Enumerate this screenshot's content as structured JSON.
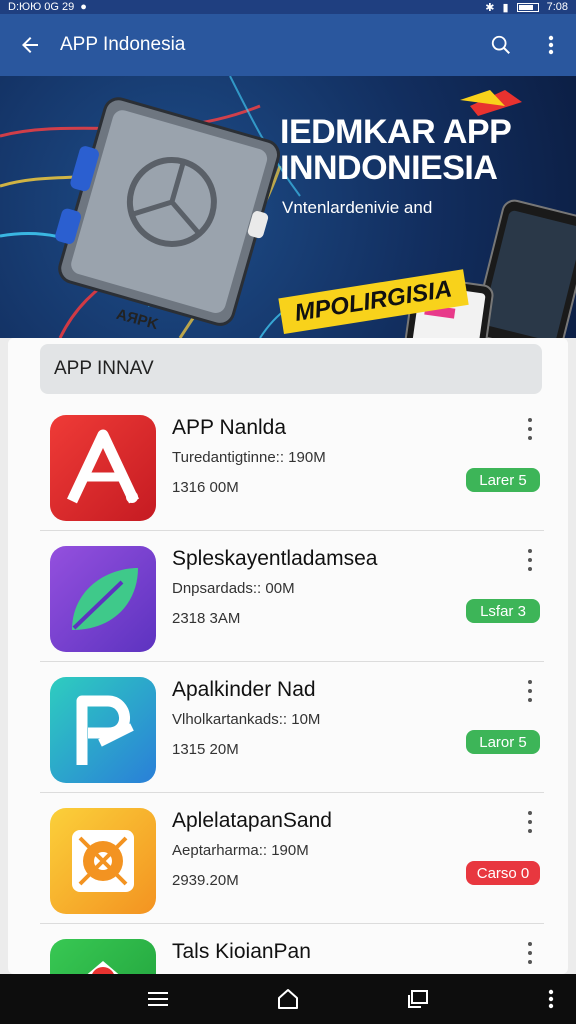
{
  "status_bar": {
    "time_left": "D:ЮЮ 0G 29",
    "time_right": "7:08"
  },
  "app_bar": {
    "title": "APP Indonesia",
    "icons": [
      "back-arrow-icon",
      "search-icon",
      "more-vert-icon"
    ]
  },
  "banner": {
    "title": "IEDMKAR APP INNDONIESIA",
    "subtitle": "Vntenlardenivie and",
    "tag": "MPOLIRGISIA",
    "card_label": "AЯPK",
    "colors": {
      "background": "#14336a",
      "tag": "#f8d21b"
    }
  },
  "section": {
    "header": "APP INNAV"
  },
  "apps": [
    {
      "name": "APP Nanlda",
      "meta": "Turedantigtinne:: 190M",
      "size": "1316 00M",
      "button": "Larer 5",
      "button_color": "#3db558",
      "icon": "letter-a-icon",
      "icon_colors": [
        "#e8322f",
        "#c51b22"
      ]
    },
    {
      "name": "Spleskayentladamsea",
      "meta": "Dnpsardads:: 00M",
      "size": "2318 3AM",
      "button": "Lsfar 3",
      "button_color": "#3db558",
      "icon": "leaf-icon",
      "icon_colors": [
        "#8a48d8",
        "#5d33c0"
      ]
    },
    {
      "name": "Apalkinder Nad",
      "meta": "Vlholkartankads:: 10M",
      "size": "1315 20M",
      "button": "Laror 5",
      "button_color": "#3db558",
      "icon": "letter-p-icon",
      "icon_colors": [
        "#2ec4c0",
        "#2a7fd8"
      ]
    },
    {
      "name": "AplelatapanSand",
      "meta": "Aeptarharma:: 190M",
      "size": "2939.20M",
      "button": "Carso 0",
      "button_color": "#e8373f",
      "icon": "target-icon",
      "icon_colors": [
        "#f9c533",
        "#f39321"
      ]
    },
    {
      "name": "Tals KioianPan",
      "meta": "",
      "size": "",
      "button": "",
      "button_color": "#3db558",
      "icon": "map-pin-icon",
      "icon_colors": [
        "#2fbf4a",
        "#1f9e3a"
      ]
    }
  ],
  "nav_bar": {
    "icons": [
      "menu-icon",
      "home-icon",
      "recents-icon",
      "more-vert-icon"
    ]
  }
}
